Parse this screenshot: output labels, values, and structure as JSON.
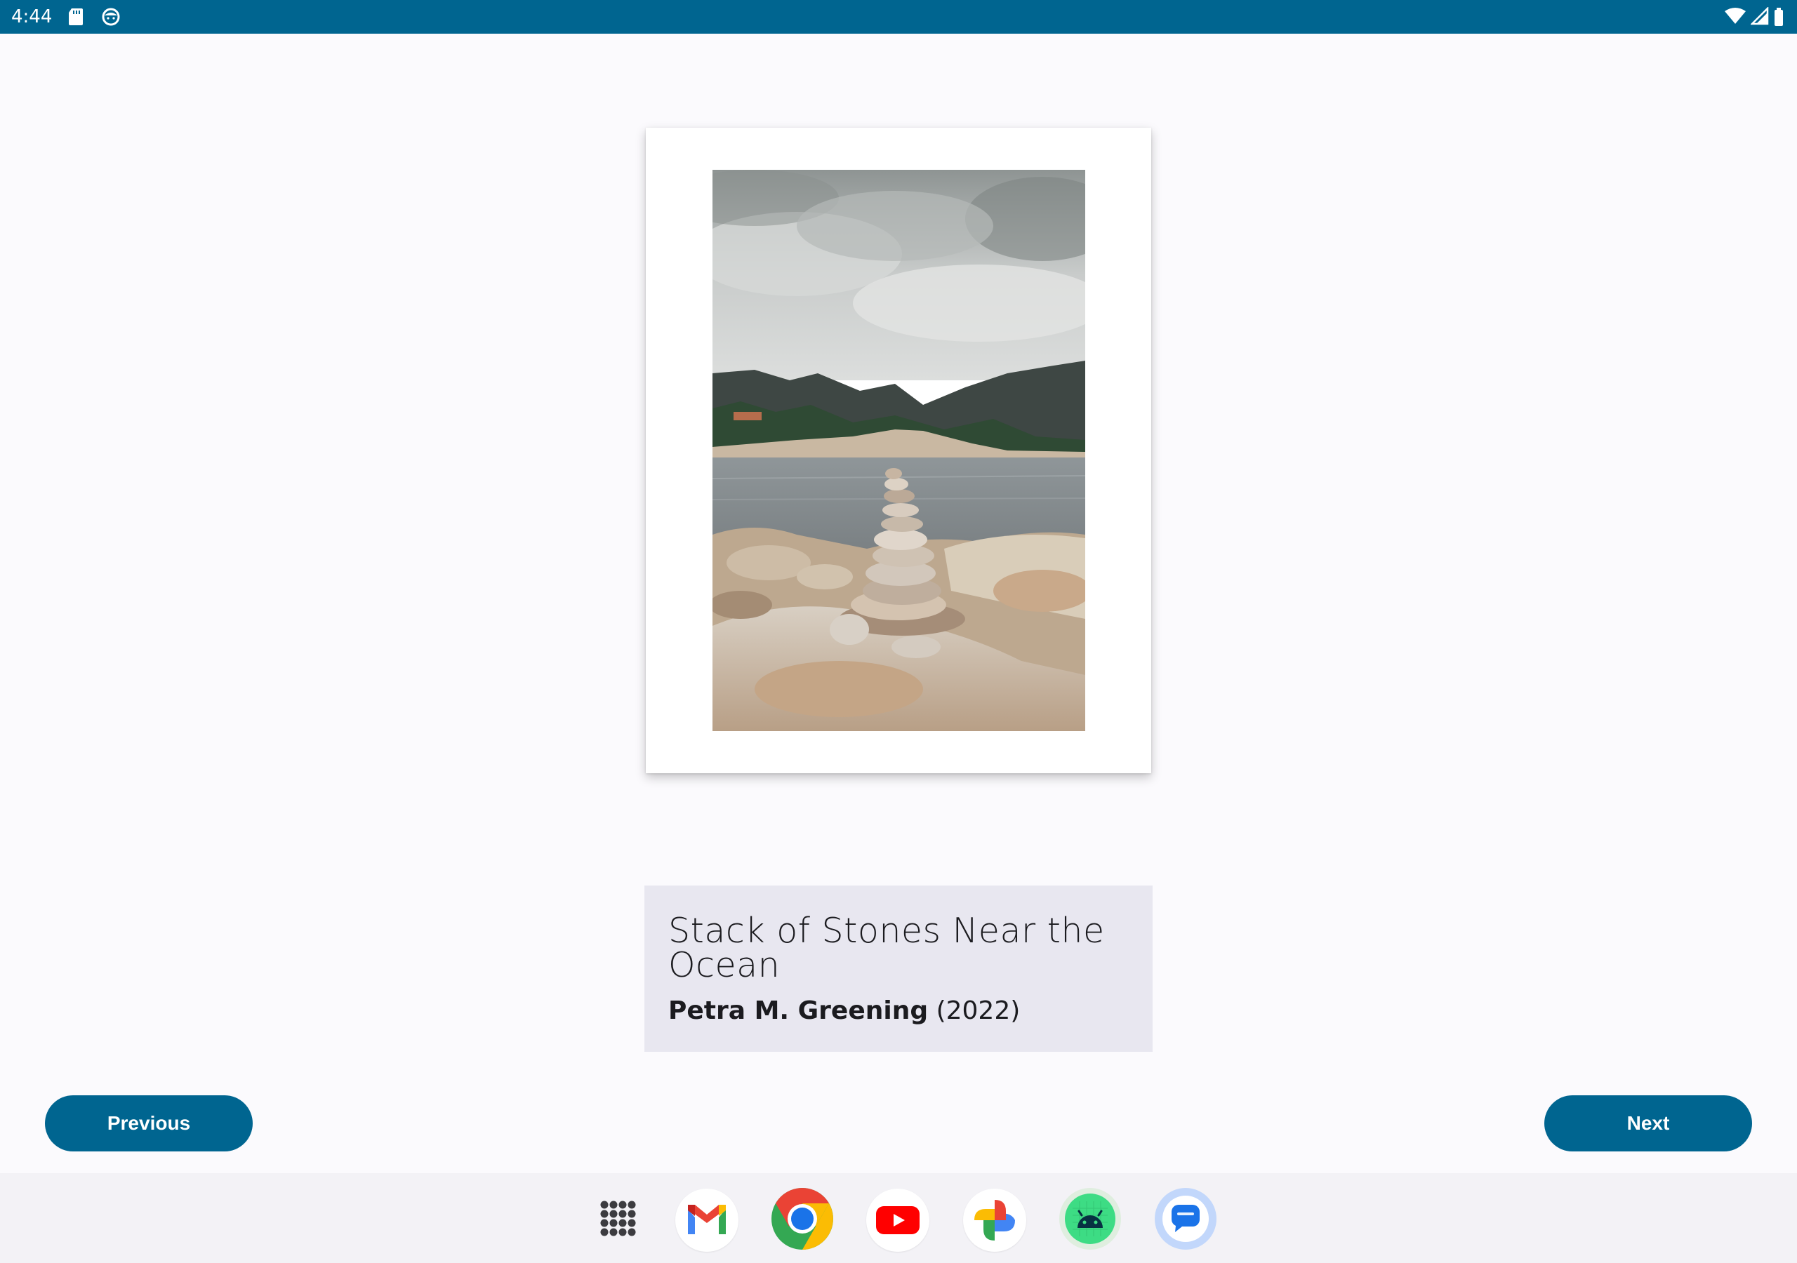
{
  "status_bar": {
    "time": "4:44",
    "left_icons": [
      "sd-card-icon",
      "face-icon"
    ],
    "right_icons": [
      "wifi-icon",
      "signal-icon",
      "battery-icon"
    ],
    "background": "#006590"
  },
  "artwork": {
    "image_name": "stacked-stones-photo",
    "title": "Stack of Stones Near the Ocean",
    "artist": "Petra M. Greening",
    "year": "(2022)"
  },
  "navigation": {
    "previous_label": "Previous",
    "next_label": "Next",
    "button_color": "#006590"
  },
  "dock": {
    "apps": [
      {
        "name": "app-drawer-icon"
      },
      {
        "name": "gmail-icon"
      },
      {
        "name": "chrome-icon"
      },
      {
        "name": "youtube-icon"
      },
      {
        "name": "photos-icon"
      },
      {
        "name": "android-studio-icon"
      },
      {
        "name": "messages-icon"
      }
    ]
  }
}
